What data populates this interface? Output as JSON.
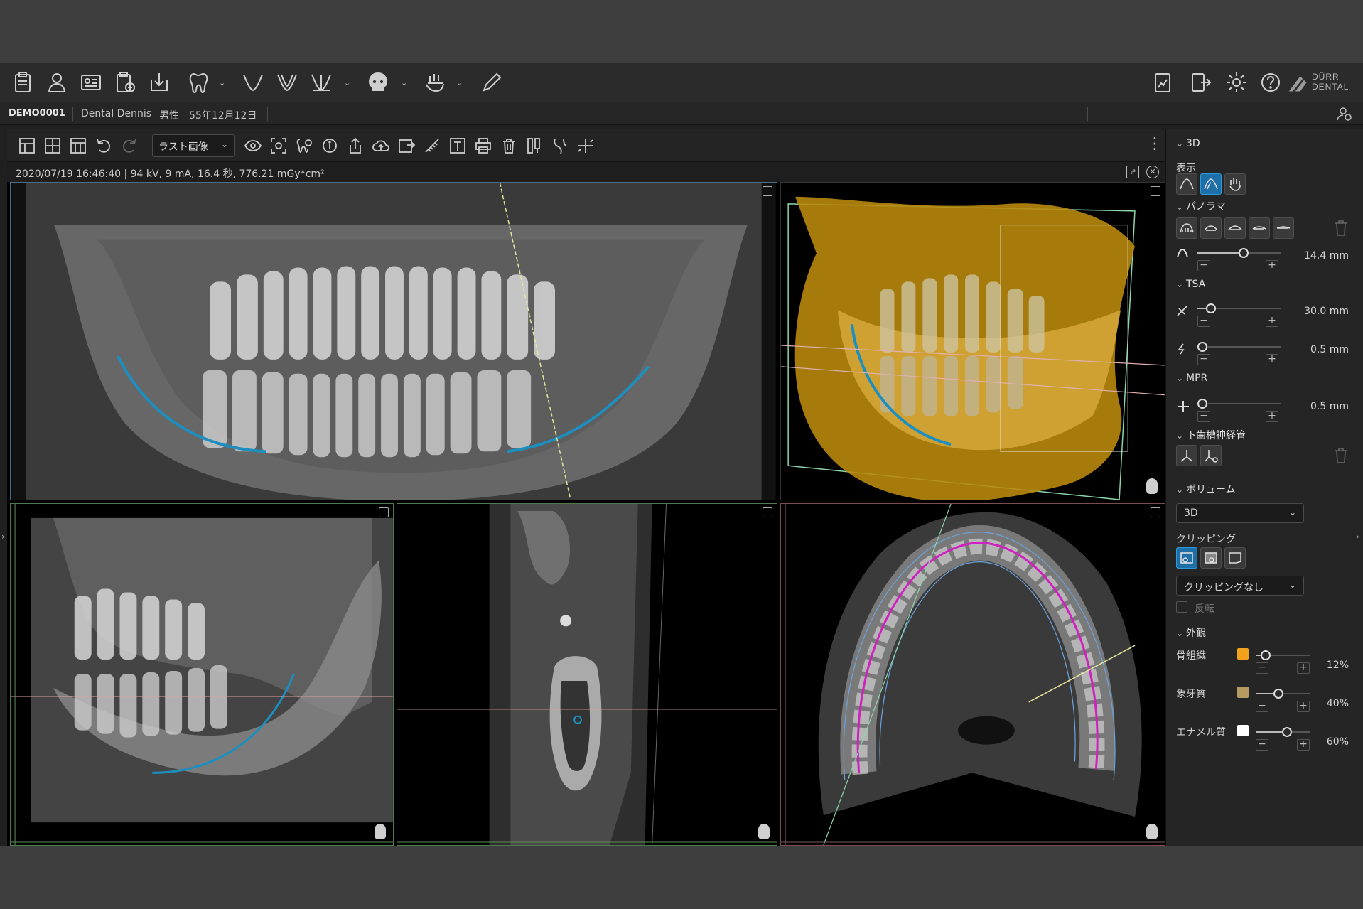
{
  "patient": {
    "id": "DEMO0001",
    "name": "Dental Dennis",
    "sex": "男性",
    "dob": "55年12月12日"
  },
  "main_toolbar": {
    "icons": [
      "clipboard-icon",
      "patient-icon",
      "id-card-icon",
      "add-exam-icon",
      "import-icon",
      "tooth-icon",
      "implant-v-icon",
      "implant-v2-icon",
      "implant-fan-icon",
      "skull-icon",
      "ortho-icon",
      "pen-icon"
    ],
    "right_icons": [
      "report-icon",
      "export-icon",
      "settings-icon",
      "help-icon"
    ],
    "brand_line1": "DÜRR",
    "brand_line2": "DENTAL"
  },
  "view_toolbar": {
    "select_value": "ラスト画像",
    "icons": [
      "layout1-icon",
      "layout2-icon",
      "layout3-icon",
      "rotate-left-icon",
      "rotate-right-icon",
      "eye-icon",
      "fit-icon",
      "tooth-search-icon",
      "info-icon",
      "share-icon",
      "upload-cloud-icon",
      "export-box-icon",
      "ruler-icon",
      "text-icon",
      "print-icon",
      "delete-icon",
      "measure-icon",
      "nerve-icon",
      "crosshair-icon"
    ]
  },
  "info": {
    "text": "2020/07/19 16:46:40 | 94 kV, 9 mA, 16.4 秒, 776.21 mGy*cm²"
  },
  "panel": {
    "sec_3d": "3D",
    "display_label": "表示",
    "sec_panorama": "パノラマ",
    "panorama_value": "14.4 mm",
    "panorama_fraction": 0.56,
    "sec_tsa": "TSA",
    "tsa1_value": "30.0 mm",
    "tsa1_fraction": 0.12,
    "tsa2_value": "0.5 mm",
    "tsa2_fraction": 0.0,
    "sec_mpr": "MPR",
    "mpr_value": "0.5 mm",
    "mpr_fraction": 0.0,
    "sec_nerve": "下歯槽神経管",
    "sec_volume": "ボリューム",
    "volume_value": "3D",
    "clipping_label": "クリッピング",
    "clipping_value": "クリッピングなし",
    "invert_label": "反転",
    "sec_appearance": "外観",
    "bone_label": "骨組織",
    "bone_value": "12%",
    "bone_fraction": 0.12,
    "bone_color": "#f2a11c",
    "dentin_label": "象牙質",
    "dentin_value": "40%",
    "dentin_fraction": 0.4,
    "dentin_color": "#b59a62",
    "enamel_label": "エナメル質",
    "enamel_value": "60%",
    "enamel_fraction": 0.6,
    "enamel_color": "#ffffff"
  },
  "colors": {
    "accent": "#2b9be0",
    "nerve": "#1c8fc0",
    "arch": "#d020c0",
    "panel_bg": "#252525"
  }
}
